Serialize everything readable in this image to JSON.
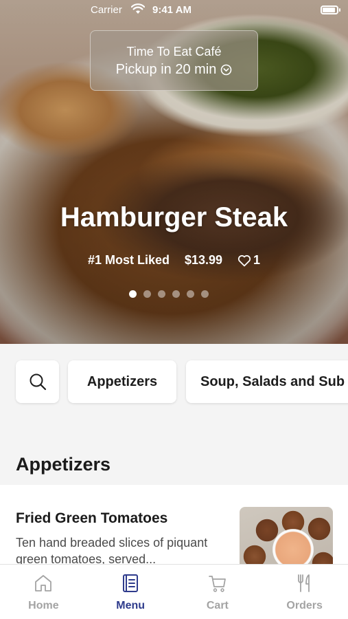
{
  "status_bar": {
    "carrier": "Carrier",
    "time": "9:41 AM"
  },
  "pickup": {
    "restaurant": "Time To Eat Café",
    "eta": "Pickup in 20 min"
  },
  "hero": {
    "title": "Hamburger Steak",
    "badge": "#1 Most Liked",
    "price": "$13.99",
    "likes": "1",
    "slide_count": 6,
    "active_slide": 1
  },
  "categories": [
    "Appetizers",
    "Soup, Salads and Sub"
  ],
  "section": {
    "title": "Appetizers"
  },
  "items": [
    {
      "name": "Fried Green Tomatoes",
      "description": "Ten hand breaded slices of piquant green tomatoes, served..."
    }
  ],
  "tabs": [
    {
      "label": "Home",
      "icon": "home-icon"
    },
    {
      "label": "Menu",
      "icon": "menu-book-icon",
      "active": true
    },
    {
      "label": "Cart",
      "icon": "cart-icon"
    },
    {
      "label": "Orders",
      "icon": "fork-knife-icon"
    }
  ],
  "colors": {
    "accent": "#2e3b8c",
    "tab_inactive": "#a3a3a3"
  }
}
